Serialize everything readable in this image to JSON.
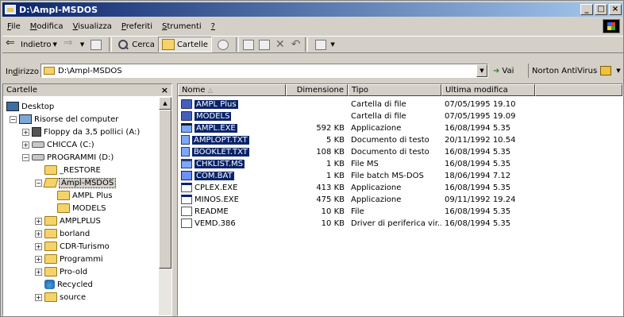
{
  "window": {
    "title": "D:\\Ampl-MSDOS",
    "controls": [
      "_",
      "□",
      "×"
    ]
  },
  "menu": [
    {
      "label": "File",
      "acc": "F",
      "rest": "ile"
    },
    {
      "label": "Modifica",
      "acc": "M",
      "rest": "odifica"
    },
    {
      "label": "Visualizza",
      "acc": "V",
      "rest": "isualizza"
    },
    {
      "label": "Preferiti",
      "acc": "P",
      "rest": "referiti"
    },
    {
      "label": "Strumenti",
      "acc": "S",
      "rest": "trumenti"
    },
    {
      "label": "?",
      "acc": "?",
      "rest": ""
    }
  ],
  "toolbar": {
    "back_label": "Indietro",
    "search_label": "Cerca",
    "folders_label": "Cartelle"
  },
  "address": {
    "label_acc": "d",
    "label_pre": "In",
    "label_post": "irizzo",
    "value": "D:\\Ampl-MSDOS",
    "go_label": "Vai",
    "norton_label": "Norton AntiVirus"
  },
  "folders_pane": {
    "title": "Cartelle",
    "close": "×",
    "tree": [
      {
        "label": "Desktop",
        "icon": "desktop-icon",
        "level": 0,
        "exp": ""
      },
      {
        "label": "Risorse del computer",
        "icon": "computer-icon",
        "level": 1,
        "exp": "−"
      },
      {
        "label": "Floppy da 3,5 pollici (A:)",
        "icon": "floppy-icon",
        "level": 2,
        "exp": "+"
      },
      {
        "label": "CHICCA (C:)",
        "icon": "drive-icon",
        "level": 2,
        "exp": "+"
      },
      {
        "label": "PROGRAMMI (D:)",
        "icon": "drive-icon",
        "level": 2,
        "exp": "−"
      },
      {
        "label": "_RESTORE",
        "icon": "folder-icon",
        "level": 3,
        "exp": ""
      },
      {
        "label": "Ampl-MSDOS",
        "icon": "folder-open-icon",
        "level": 3,
        "exp": "−",
        "selected": true
      },
      {
        "label": "AMPL Plus",
        "icon": "folder-icon",
        "level": 4,
        "exp": ""
      },
      {
        "label": "MODELS",
        "icon": "folder-icon",
        "level": 4,
        "exp": ""
      },
      {
        "label": "AMPLPLUS",
        "icon": "folder-icon",
        "level": 3,
        "exp": "+"
      },
      {
        "label": "borland",
        "icon": "folder-icon",
        "level": 3,
        "exp": "+"
      },
      {
        "label": "CDR-Turismo",
        "icon": "folder-icon",
        "level": 3,
        "exp": "+"
      },
      {
        "label": "Programmi",
        "icon": "folder-icon",
        "level": 3,
        "exp": "+"
      },
      {
        "label": "Pro-old",
        "icon": "folder-icon",
        "level": 3,
        "exp": "+"
      },
      {
        "label": "Recycled",
        "icon": "recycle-bin-icon",
        "level": 3,
        "exp": ""
      },
      {
        "label": "source",
        "icon": "folder-icon",
        "level": 3,
        "exp": "+"
      }
    ]
  },
  "files_pane": {
    "columns": [
      "Nome",
      "Dimensione",
      "Tipo",
      "Ultima modifica"
    ],
    "rows": [
      {
        "name": "AMPL Plus",
        "size": "",
        "type": "Cartella di file",
        "date": "07/05/1995 19.10",
        "icon": "folder-icon",
        "selected": true
      },
      {
        "name": "MODELS",
        "size": "",
        "type": "Cartella di file",
        "date": "07/05/1995 19.09",
        "icon": "folder-icon",
        "selected": true
      },
      {
        "name": "AMPL.EXE",
        "size": "592 KB",
        "type": "Applicazione",
        "date": "16/08/1994 5.35",
        "icon": "exe-icon",
        "selected": true
      },
      {
        "name": "AMPLOPT.TXT",
        "size": "5 KB",
        "type": "Documento di testo",
        "date": "20/11/1992 10.54",
        "icon": "text-file-icon",
        "selected": true
      },
      {
        "name": "BOOKLET.TXT",
        "size": "108 KB",
        "type": "Documento di testo",
        "date": "16/08/1994 5.35",
        "icon": "text-file-icon",
        "selected": true
      },
      {
        "name": "CHKLIST.MS",
        "size": "1 KB",
        "type": "File MS",
        "date": "16/08/1994 5.35",
        "icon": "ms-file-icon",
        "selected": true
      },
      {
        "name": "COM.BAT",
        "size": "1 KB",
        "type": "File batch MS-DOS",
        "date": "18/06/1994 7.12",
        "icon": "batch-file-icon",
        "selected": true
      },
      {
        "name": "CPLEX.EXE",
        "size": "413 KB",
        "type": "Applicazione",
        "date": "16/08/1994 5.35",
        "icon": "exe-icon",
        "selected": false
      },
      {
        "name": "MINOS.EXE",
        "size": "475 KB",
        "type": "Applicazione",
        "date": "09/11/1992 19.24",
        "icon": "exe-icon",
        "selected": false
      },
      {
        "name": "README",
        "size": "10 KB",
        "type": "File",
        "date": "16/08/1994 5.35",
        "icon": "file-icon",
        "selected": false
      },
      {
        "name": "VEMD.386",
        "size": "10 KB",
        "type": "Driver di periferica vir...",
        "date": "16/08/1994 5.35",
        "icon": "driver-file-icon",
        "selected": false
      }
    ]
  }
}
